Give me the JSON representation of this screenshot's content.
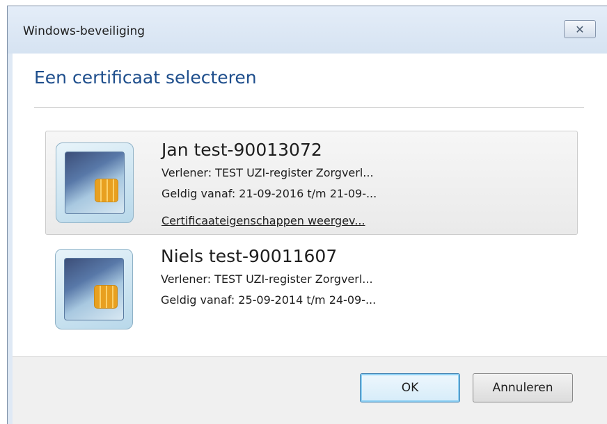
{
  "window": {
    "title": "Windows-beveiliging",
    "close_symbol": "✕"
  },
  "dialog": {
    "heading": "Een certificaat selecteren"
  },
  "certificates": [
    {
      "name": "Jan test-90013072",
      "issuer": "Verlener: TEST UZI-register Zorgverl...",
      "validity": "Geldig vanaf: 21-09-2016 t/m 21-09-...",
      "properties_link": "Certificaateigenschappen weergev...",
      "selected": true,
      "icon": "smartcard-icon"
    },
    {
      "name": "Niels test-90011607",
      "issuer": "Verlener: TEST UZI-register Zorgverl...",
      "validity": "Geldig vanaf: 25-09-2014 t/m 24-09-...",
      "selected": false,
      "icon": "smartcard-icon"
    }
  ],
  "buttons": {
    "ok": "OK",
    "cancel": "Annuleren"
  },
  "colors": {
    "heading": "#1e4e8c",
    "titlebar": "#dfe9f5",
    "default_button_glow": "#8ed0f3"
  }
}
